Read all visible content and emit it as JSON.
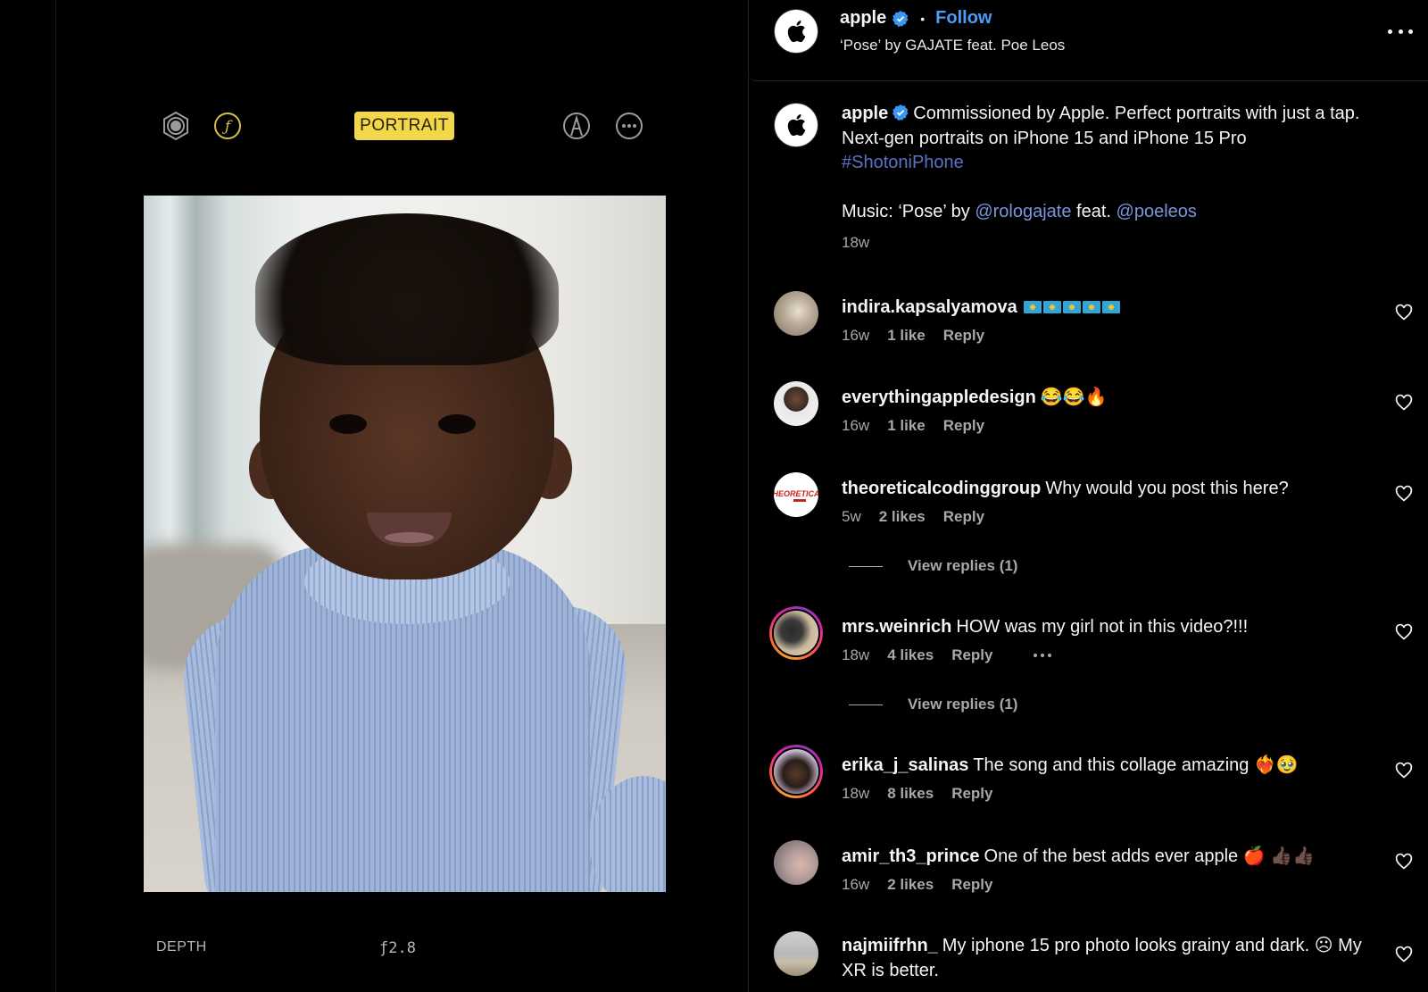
{
  "camera": {
    "mode_label": "PORTRAIT",
    "depth_label": "DEPTH",
    "fstop_value": "ƒ2.8",
    "icons": [
      "live-photo-icon",
      "aperture-f-icon",
      "markup-pen-icon",
      "more-options-icon"
    ],
    "accent_color": "#f2d74a"
  },
  "header": {
    "username": "apple",
    "verified": true,
    "follow_label": "Follow",
    "audio": "‘Pose’ by GAJATE feat. Poe Leos",
    "follow_color": "#4a9df8"
  },
  "caption": {
    "username": "apple",
    "text": "Commissioned by Apple. Perfect portraits with just a tap. Next-gen portraits on iPhone 15 and iPhone 15 Pro",
    "hashtag": "#ShotoniPhone",
    "music_prefix": "Music: ‘Pose’ by",
    "mention1": "@rologajate",
    "music_mid": "feat.",
    "mention2": "@poeleos",
    "time": "18w"
  },
  "comments": [
    {
      "username": "indira.kapsalyamova",
      "text": "",
      "flags": 5,
      "time": "16w",
      "likes": "1 like",
      "reply": "Reply"
    },
    {
      "username": "everythingappledesign",
      "text": "😂😂🔥",
      "time": "16w",
      "likes": "1 like",
      "reply": "Reply"
    },
    {
      "username": "theoreticalcodinggroup",
      "text": "Why would you post this here?",
      "time": "5w",
      "likes": "2 likes",
      "reply": "Reply",
      "view_replies": "View replies (1)"
    },
    {
      "username": "mrs.weinrich",
      "text": "HOW was my girl not in this video?!!!",
      "time": "18w",
      "likes": "4 likes",
      "reply": "Reply",
      "view_replies": "View replies (1)",
      "has_story_ring": true
    },
    {
      "username": "erika_j_salinas",
      "text": "The song and this collage amazing ❤️‍🔥🥹",
      "time": "18w",
      "likes": "8 likes",
      "reply": "Reply",
      "has_story_ring": true
    },
    {
      "username": "amir_th3_prince",
      "text": "One of the best adds ever apple 🍎 👍🏿👍🏿",
      "time": "16w",
      "likes": "2 likes",
      "reply": "Reply"
    },
    {
      "username": "najmiifrhn_",
      "text": "My iphone 15 pro photo looks grainy and dark. ☹ My XR is better."
    }
  ]
}
